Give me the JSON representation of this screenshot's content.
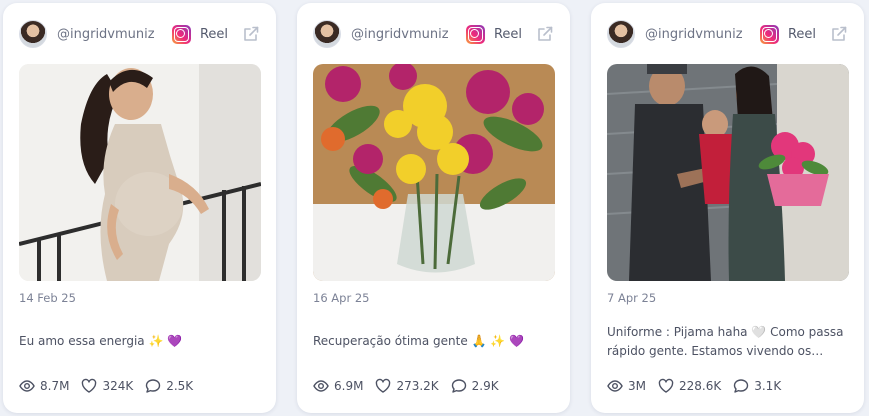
{
  "posts": [
    {
      "handle": "@ingridvmuniz",
      "platform_label": "Reel",
      "date": "14 Feb 25",
      "caption": "Eu amo essa energia ✨ 💜",
      "views": "8.7M",
      "likes": "324K",
      "comments": "2.5K",
      "thumbnail": "pregnant woman in beige dress"
    },
    {
      "handle": "@ingridvmuniz",
      "platform_label": "Reel",
      "date": "16 Apr 25",
      "caption": "Recuperação ótima gente 🙏 ✨ 💜",
      "views": "6.9M",
      "likes": "273.2K",
      "comments": "2.9K",
      "thumbnail": "flower bouquet in vase"
    },
    {
      "handle": "@ingridvmuniz",
      "platform_label": "Reel",
      "date": "7 Apr 25",
      "caption": "Uniforme : Pijama haha 🤍 Como passa rápido gente. Estamos vivendo os dias...",
      "views": "3M",
      "likes": "228.6K",
      "comments": "3.1K",
      "thumbnail": "couple holding newborn and flowers"
    }
  ],
  "icons": {
    "platform": "instagram-icon",
    "external": "external-link-icon",
    "views": "eye-icon",
    "likes": "heart-icon",
    "comments": "comment-icon"
  },
  "colors": {
    "background": "#eef1f7",
    "card": "#ffffff",
    "text_muted": "#6d7385",
    "text": "#4d5263"
  }
}
